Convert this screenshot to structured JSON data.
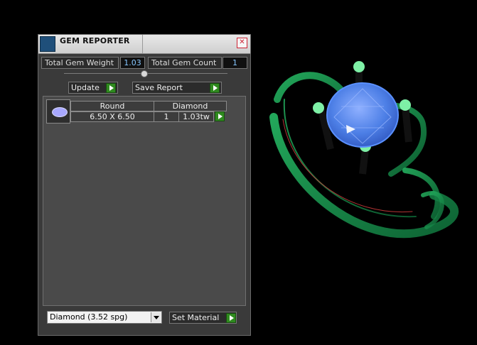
{
  "panel": {
    "title": "GEM REPORTER",
    "close_label": "✕",
    "total_weight_label": "Total Gem Weight",
    "total_weight_value": "1.03",
    "total_count_label": "Total Gem Count",
    "total_count_value": "1",
    "update_label": "Update",
    "save_report_label": "Save Report",
    "table": {
      "header_shape": "Round",
      "header_material": "Diamond",
      "size": "6.50 X 6.50",
      "count": "1",
      "weight": "1.03tw"
    },
    "material_select_value": "Diamond   (3.52 spg)",
    "set_material_label": "Set Material"
  },
  "colors": {
    "ring_green": "#1a8f4a",
    "stone_blue": "#4d7fe6",
    "accent_green": "#2f8a1f"
  },
  "icons": {
    "app_icon": "gem-reporter-icon",
    "close_icon": "close-icon",
    "play_icon": "play-icon",
    "dropdown_icon": "chevron-down-icon",
    "gem_thumb": "gem-thumbnail-icon"
  }
}
